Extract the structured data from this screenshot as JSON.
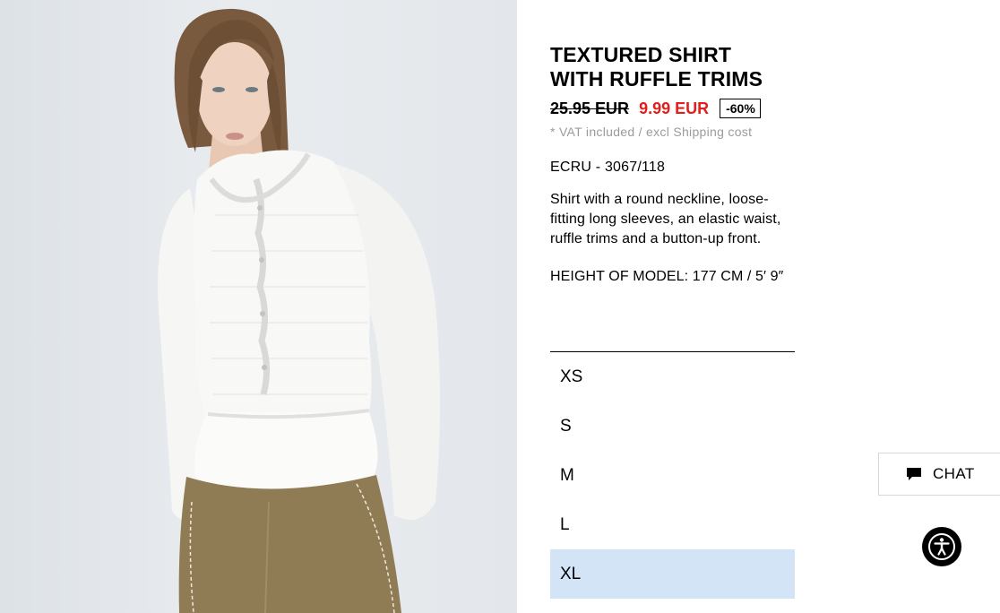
{
  "product": {
    "title_line1": "TEXTURED SHIRT",
    "title_line2": "WITH RUFFLE TRIMS",
    "old_price": "25.95 EUR",
    "new_price": "9.99 EUR",
    "discount": "-60%",
    "vat_note": "* VAT included / excl Shipping cost",
    "color_ref": "ECRU - 3067/118",
    "description": "Shirt with a round neckline, loose-fitting long sleeves, an elastic waist, ruffle trims and a button-up front.",
    "model_height": "HEIGHT OF MODEL: 177 CM / 5′ 9″"
  },
  "sizes": {
    "items": [
      "XS",
      "S",
      "M",
      "L",
      "XL"
    ],
    "selected": "XL"
  },
  "chat": {
    "label": "CHAT",
    "icon": "chat-bubble-icon"
  },
  "accessibility": {
    "icon": "accessibility-icon"
  },
  "colors": {
    "sale_price": "#e0201b",
    "selected_size_bg": "#d3e4f6",
    "vat_text": "#9b9b9b"
  }
}
